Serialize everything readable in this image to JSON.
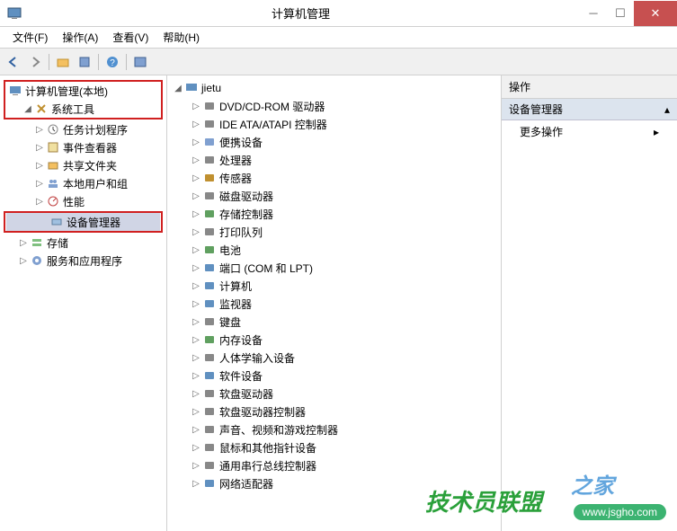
{
  "title": "计算机管理",
  "menu": {
    "file": "文件(F)",
    "actions": "操作(A)",
    "view": "查看(V)",
    "help": "帮助(H)"
  },
  "leftTree": {
    "root": "计算机管理(本地)",
    "systemTools": "系统工具",
    "taskScheduler": "任务计划程序",
    "eventViewer": "事件查看器",
    "sharedFolders": "共享文件夹",
    "localUsers": "本地用户和组",
    "performance": "性能",
    "deviceManager": "设备管理器",
    "storage": "存储",
    "servicesApps": "服务和应用程序"
  },
  "devTree": {
    "computer": "jietu",
    "items": [
      "DVD/CD-ROM 驱动器",
      "IDE ATA/ATAPI 控制器",
      "便携设备",
      "处理器",
      "传感器",
      "磁盘驱动器",
      "存储控制器",
      "打印队列",
      "电池",
      "端口 (COM 和 LPT)",
      "计算机",
      "监视器",
      "键盘",
      "内存设备",
      "人体学输入设备",
      "软件设备",
      "软盘驱动器",
      "软盘驱动器控制器",
      "声音、视频和游戏控制器",
      "鼠标和其他指针设备",
      "通用串行总线控制器",
      "网络适配器"
    ]
  },
  "rightPanel": {
    "header": "操作",
    "sub": "设备管理器",
    "more": "更多操作"
  },
  "watermark": {
    "text": "技术员联盟",
    "url": "www.jsgho.com",
    "sub": "之家"
  }
}
